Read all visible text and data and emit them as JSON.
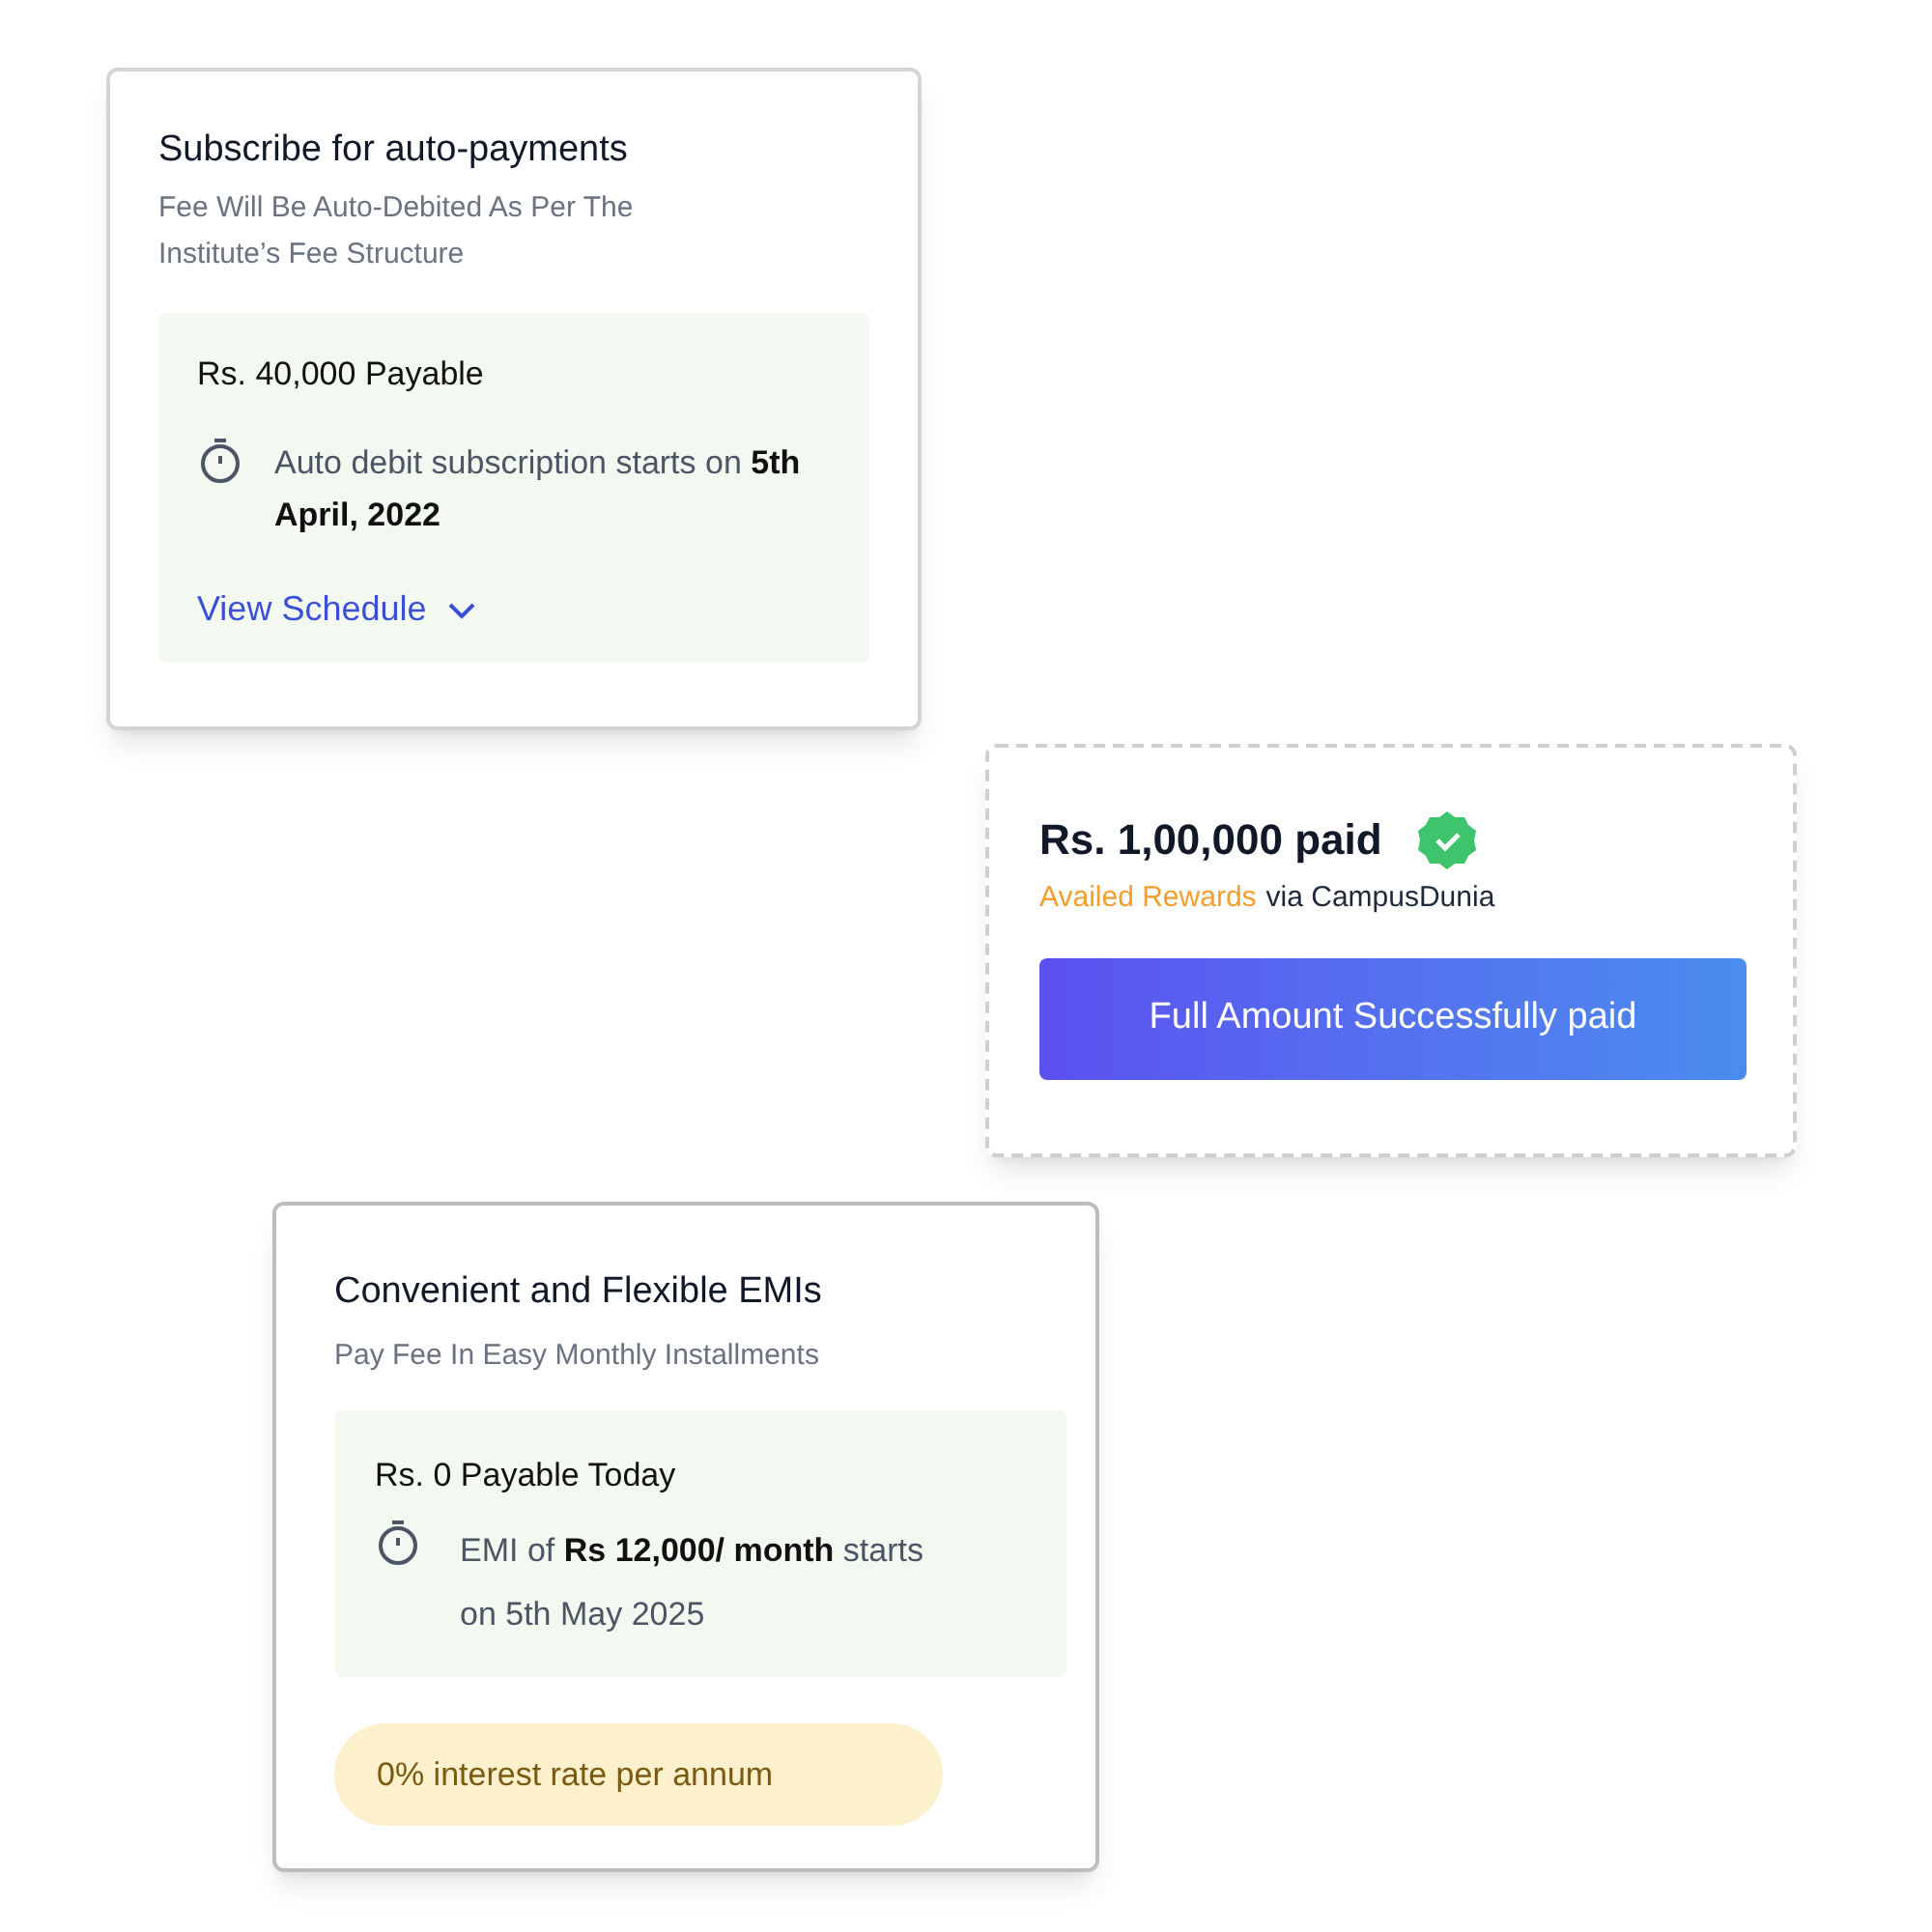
{
  "cards": [
    {
      "kind": "subscription",
      "title": "Subscribe for auto-payments",
      "subtitle": "Fee Will Be Auto-Debited As Per The Institute’s Fee Structure",
      "payable": "Rs. 40,000 Payable",
      "note": "Auto debit subscription starts on **5th April, 2022**",
      "link": "View Schedule"
    },
    {
      "kind": "paid",
      "title": "Rs. 1,00,000 paid",
      "rewards": "Availed Rewards",
      "via": "via CampusDunia",
      "button": "Full Amount Successfully paid"
    },
    {
      "kind": "emi",
      "title": "Convenient and Flexible EMIs",
      "subtitle": "Pay Fee In Easy Monthly Installments",
      "payable": "Rs. 0 Payable Today",
      "note": "EMI of **Rs 12,000/ month** starts on 5th May 2025",
      "pill": "0% interest rate per annum"
    }
  ]
}
